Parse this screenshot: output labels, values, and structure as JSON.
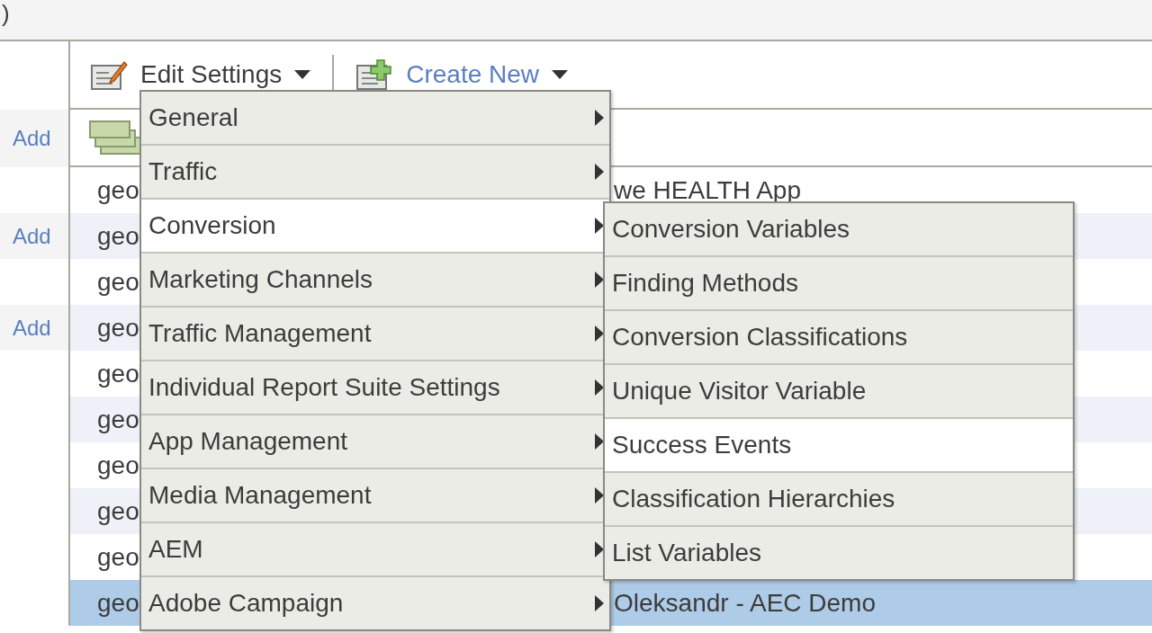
{
  "top_strip": {
    "text": ")"
  },
  "toolbar": {
    "edit_settings": "Edit Settings",
    "create_new": "Create New"
  },
  "header_link": "Add",
  "rows": [
    {
      "side": "",
      "cell_1": "geo",
      "cell_2": "we HEALTH App",
      "selected": false
    },
    {
      "side": "Add",
      "cell_1": "geo",
      "cell_2": "",
      "selected": false
    },
    {
      "side": "",
      "cell_1": "geo",
      "cell_2": "",
      "selected": false
    },
    {
      "side": "Add",
      "cell_1": "geo",
      "cell_2": "",
      "selected": false
    },
    {
      "side": "",
      "cell_1": "geo",
      "cell_2": "",
      "selected": false
    },
    {
      "side": "",
      "cell_1": "geo",
      "cell_2": "",
      "selected": false
    },
    {
      "side": "",
      "cell_1": "geo",
      "cell_2": "",
      "selected": false
    },
    {
      "side": "",
      "cell_1": "geo",
      "cell_2": "",
      "selected": false
    },
    {
      "side": "",
      "cell_1": "geo",
      "cell_2": "",
      "selected": false
    },
    {
      "side": "",
      "cell_1": "geo",
      "cell_2": "Oleksandr - AEC Demo",
      "selected": true
    }
  ],
  "menu": {
    "items": [
      {
        "label": "General",
        "selected": false
      },
      {
        "label": "Traffic",
        "selected": false
      },
      {
        "label": "Conversion",
        "selected": true
      },
      {
        "label": "Marketing Channels",
        "selected": false
      },
      {
        "label": "Traffic Management",
        "selected": false
      },
      {
        "label": "Individual Report Suite Settings",
        "selected": false
      },
      {
        "label": "App Management",
        "selected": false
      },
      {
        "label": "Media Management",
        "selected": false
      },
      {
        "label": "AEM",
        "selected": false
      },
      {
        "label": "Adobe Campaign",
        "selected": false
      }
    ]
  },
  "submenu": {
    "items": [
      {
        "label": "Conversion Variables",
        "selected": false
      },
      {
        "label": "Finding Methods",
        "selected": false
      },
      {
        "label": "Conversion Classifications",
        "selected": false
      },
      {
        "label": "Unique Visitor Variable",
        "selected": false
      },
      {
        "label": "Success Events",
        "selected": true
      },
      {
        "label": "Classification Hierarchies",
        "selected": false
      },
      {
        "label": "List Variables",
        "selected": false
      }
    ]
  }
}
